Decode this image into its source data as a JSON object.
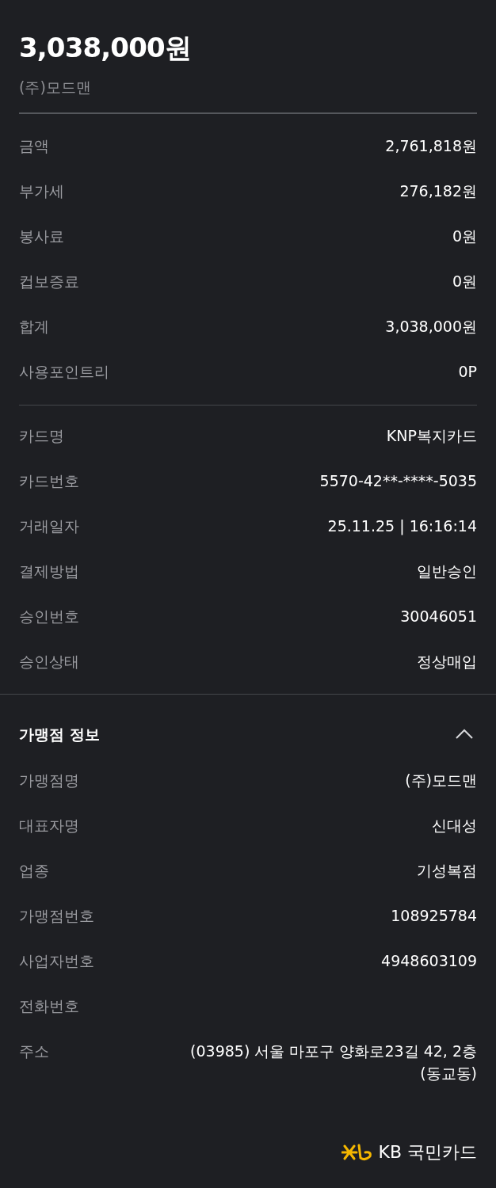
{
  "total": "3,038,000원",
  "merchant": "(주)모드맨",
  "amounts": [
    {
      "label": "금액",
      "value": "2,761,818원"
    },
    {
      "label": "부가세",
      "value": "276,182원"
    },
    {
      "label": "봉사료",
      "value": "0원"
    },
    {
      "label": "컵보증료",
      "value": "0원"
    },
    {
      "label": "합계",
      "value": "3,038,000원"
    },
    {
      "label": "사용포인트리",
      "value": "0P"
    }
  ],
  "card": [
    {
      "label": "카드명",
      "value": "KNP복지카드"
    },
    {
      "label": "카드번호",
      "value": "5570-42**-****-5035"
    },
    {
      "label": "거래일자",
      "value": "25.11.25 | 16:16:14"
    },
    {
      "label": "결제방법",
      "value": "일반승인"
    },
    {
      "label": "승인번호",
      "value": "30046051"
    },
    {
      "label": "승인상태",
      "value": "정상매입"
    }
  ],
  "merchant_info": {
    "title": "가맹점 정보",
    "expanded": true,
    "rows": [
      {
        "label": "가맹점명",
        "value": "(주)모드맨"
      },
      {
        "label": "대표자명",
        "value": "신대성"
      },
      {
        "label": "업종",
        "value": "기성복점"
      },
      {
        "label": "가맹점번호",
        "value": "108925784"
      },
      {
        "label": "사업자번호",
        "value": "4948603109"
      },
      {
        "label": "전화번호"
      },
      {
        "label": "주소",
        "value_lines": [
          "(03985) 서울 마포구 양화로23길 42, 2층",
          "(동교동)"
        ]
      }
    ]
  },
  "brand": "KB 국민카드"
}
